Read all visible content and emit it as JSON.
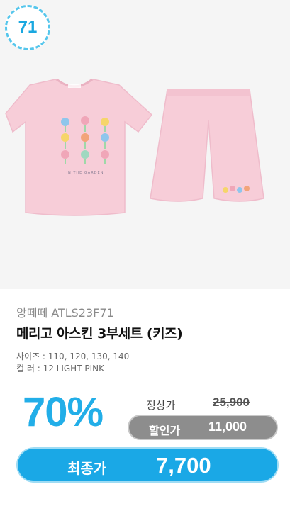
{
  "badge": {
    "number": "71"
  },
  "product": {
    "brand": "앙떼떼 ATLS23F71",
    "title": "메리고 아스킨 3부세트 (키즈)",
    "sizes": "사이즈 : 110, 120, 130, 140",
    "color": "컬    러 : 12 LIGHT PINK",
    "garment_color": "#f7cdd8",
    "tshirt_print_text": "IN THE GARDEN"
  },
  "pricing": {
    "discount": "70%",
    "regular_label": "정상가",
    "regular_price": "25,900",
    "sale_label": "할인가",
    "sale_price": "11,000",
    "final_label": "최종가",
    "final_price": "7,700",
    "accent_color": "#1aa8e6"
  }
}
